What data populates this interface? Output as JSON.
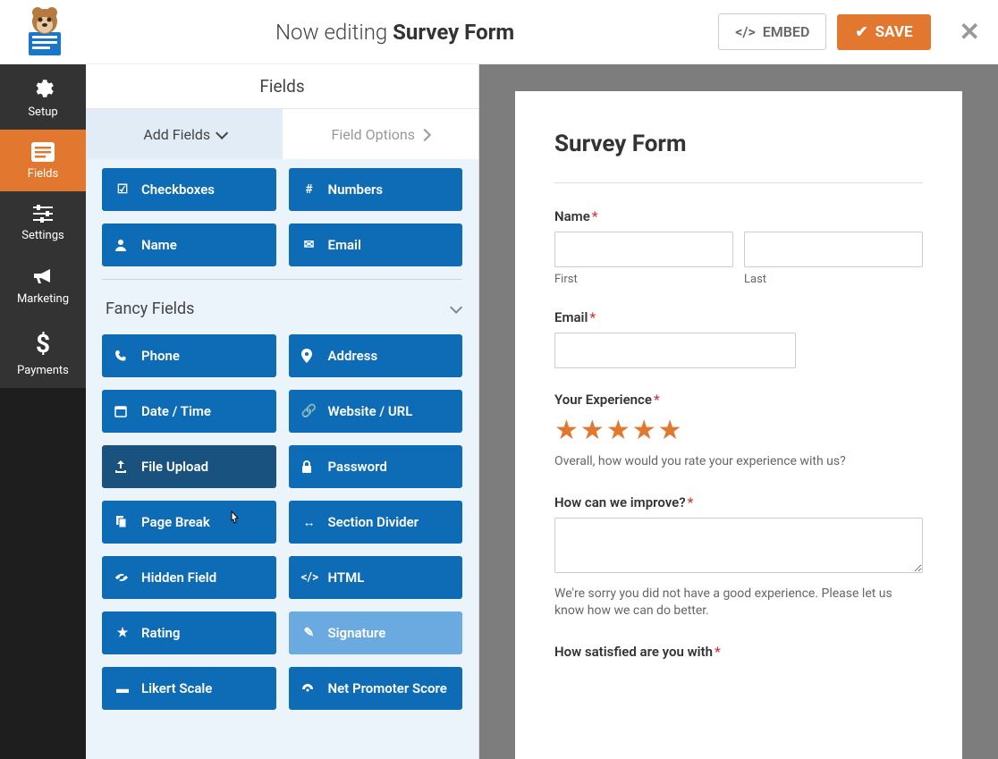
{
  "header": {
    "editing_prefix": "Now editing",
    "form_name": "Survey Form",
    "embed_label": "EMBED",
    "save_label": "SAVE"
  },
  "sidebar": {
    "items": [
      {
        "label": "Setup",
        "icon": "gear"
      },
      {
        "label": "Fields",
        "icon": "list"
      },
      {
        "label": "Settings",
        "icon": "sliders"
      },
      {
        "label": "Marketing",
        "icon": "bullhorn"
      },
      {
        "label": "Payments",
        "icon": "dollar"
      }
    ]
  },
  "panel": {
    "header": "Fields",
    "tab_add": "Add Fields",
    "tab_options": "Field Options",
    "standard_fields": [
      {
        "label": "Checkboxes",
        "icon": "check-square"
      },
      {
        "label": "Numbers",
        "icon": "hash"
      },
      {
        "label": "Name",
        "icon": "user"
      },
      {
        "label": "Email",
        "icon": "envelope"
      }
    ],
    "fancy_section": "Fancy Fields",
    "fancy_fields": [
      {
        "label": "Phone",
        "icon": "phone"
      },
      {
        "label": "Address",
        "icon": "map-marker"
      },
      {
        "label": "Date / Time",
        "icon": "calendar"
      },
      {
        "label": "Website / URL",
        "icon": "link"
      },
      {
        "label": "File Upload",
        "icon": "upload"
      },
      {
        "label": "Password",
        "icon": "lock"
      },
      {
        "label": "Page Break",
        "icon": "files"
      },
      {
        "label": "Section Divider",
        "icon": "arrows-h"
      },
      {
        "label": "Hidden Field",
        "icon": "eye-slash"
      },
      {
        "label": "HTML",
        "icon": "code"
      },
      {
        "label": "Rating",
        "icon": "star"
      },
      {
        "label": "Signature",
        "icon": "pencil"
      },
      {
        "label": "Likert Scale",
        "icon": "ellipsis"
      },
      {
        "label": "Net Promoter Score",
        "icon": "dashboard"
      }
    ]
  },
  "form": {
    "title": "Survey Form",
    "name_label": "Name",
    "first_label": "First",
    "last_label": "Last",
    "email_label": "Email",
    "experience_label": "Your Experience",
    "experience_help": "Overall, how would you rate your experience with us?",
    "improve_label": "How can we improve?",
    "improve_help": "We're sorry you did not have a good experience. Please let us know how we can do better.",
    "satisfied_label": "How satisfied are you with"
  },
  "colors": {
    "accent": "#e27730",
    "primary_blue": "#0e6bb5"
  }
}
